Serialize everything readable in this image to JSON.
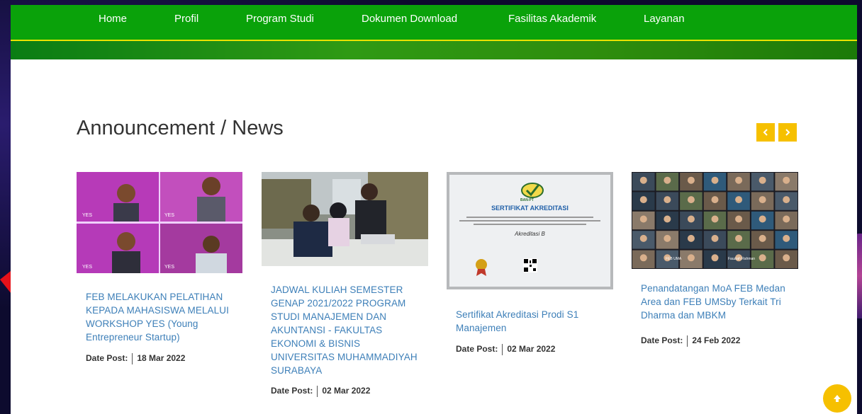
{
  "nav": {
    "items": [
      {
        "label": "Home"
      },
      {
        "label": "Profil"
      },
      {
        "label": "Program Studi"
      },
      {
        "label": "Dokumen Download"
      },
      {
        "label": "Fasilitas Akademik"
      },
      {
        "label": "Layanan"
      }
    ]
  },
  "section": {
    "title": "Announcement / News"
  },
  "carousel": {
    "prev_icon": "chevron-left-icon",
    "next_icon": "chevron-right-icon"
  },
  "cards": [
    {
      "title": "FEB MELAKUKAN PELATIHAN KEPADA MAHASISWA MELALUI WORKSHOP YES (Young Entrepreneur Startup)",
      "date_label": "Date Post:",
      "date": "18 Mar 2022"
    },
    {
      "title": "JADWAL KULIAH SEMESTER GENAP 2021/2022 PROGRAM STUDI MANAJEMEN DAN AKUNTANSI - FAKULTAS EKONOMI & BISNIS UNIVERSITAS MUHAMMADIYAH SURABAYA",
      "date_label": "Date Post:",
      "date": "02 Mar 2022"
    },
    {
      "title": "Sertifikat Akreditasi Prodi S1 Manajemen",
      "date_label": "Date Post:",
      "date": "02 Mar 2022",
      "image_texts": {
        "heading": "SERTIFIKAT AKREDITASI",
        "grade": "Akreditasi B",
        "logo": "BAN-PT"
      }
    },
    {
      "title": "Penandatangan MoA FEB Medan Area dan FEB UMSby Terkait Tri Dharma dan MBKM",
      "date_label": "Date Post:",
      "date": "24 Feb 2022",
      "image_texts": {
        "tile_a": "FEB UMA",
        "tile_b": "Fauziah Rahman"
      }
    }
  ],
  "colors": {
    "nav_bg": "#0aa20a",
    "accent_yellow": "#f6c000",
    "link_blue": "#3d7fb8"
  }
}
